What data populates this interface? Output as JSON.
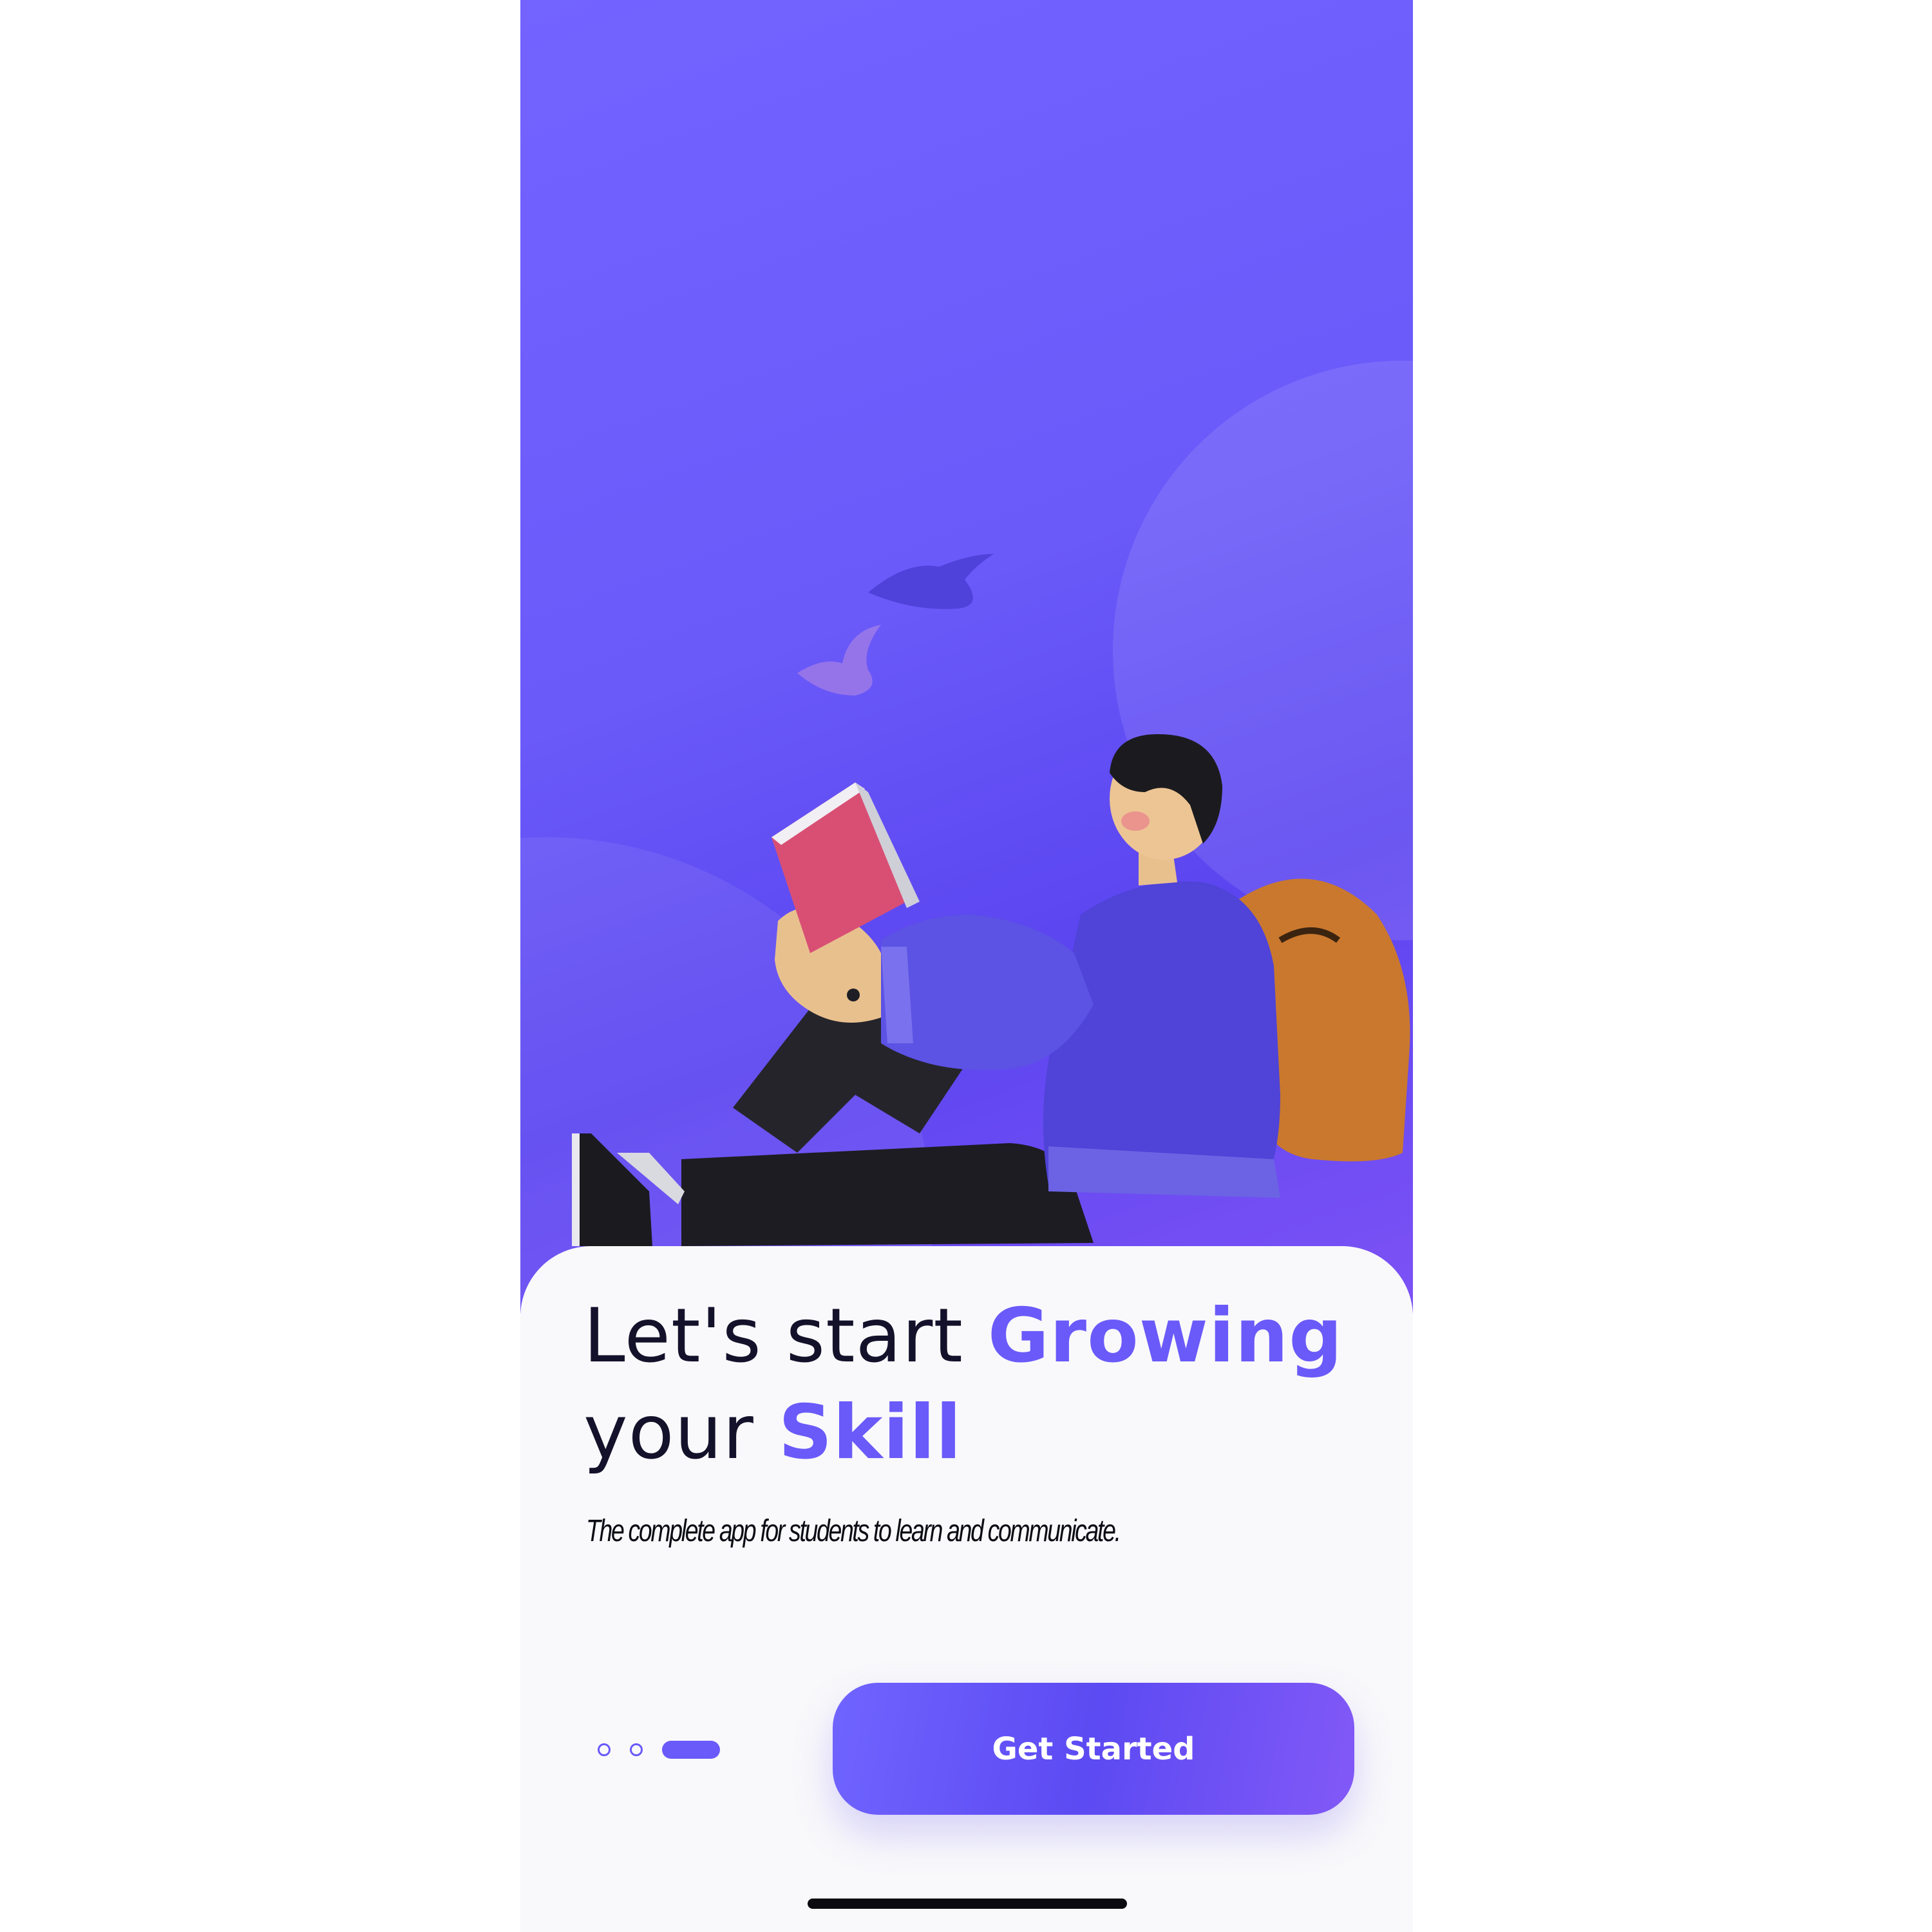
{
  "onboarding": {
    "headline_part1": "Let's start ",
    "headline_accent1": "Growing",
    "headline_part2": "your ",
    "headline_accent2": "Skill",
    "subtitle": "The complete app for students to learn and communicate.",
    "cta_label": "Get Started",
    "pagination": {
      "total": 3,
      "active_index": 2
    }
  },
  "colors": {
    "accent": "#6a5af9",
    "hero_background": "#6a5af9",
    "text_dark": "#14112b",
    "sheet_background": "#f9f9fb"
  },
  "icons": {
    "illustration": "student-reading-illustration",
    "birds": "birds-icon"
  }
}
